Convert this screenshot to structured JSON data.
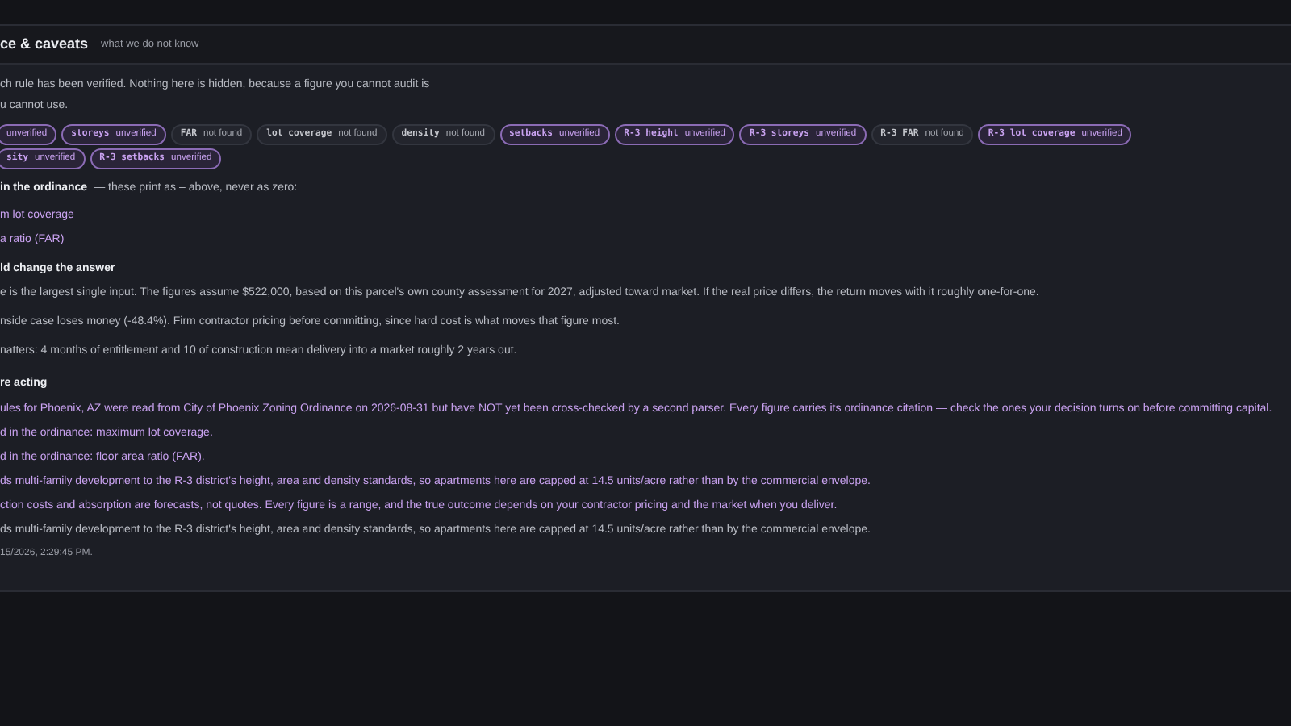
{
  "header": {
    "title": "ce & caveats",
    "subtitle": "what we do not know"
  },
  "intro": [
    "ch rule has been verified. Nothing here is hidden, because a figure you cannot audit is",
    "u cannot use."
  ],
  "badge_rows": [
    [
      {
        "status": "unverified",
        "kind": "unverified"
      },
      {
        "name": "storeys",
        "status": "unverified",
        "kind": "unverified"
      },
      {
        "name": "FAR",
        "status": "not found",
        "kind": "missing"
      },
      {
        "name": "lot coverage",
        "status": "not found",
        "kind": "missing"
      },
      {
        "name": "density",
        "status": "not found",
        "kind": "missing"
      },
      {
        "name": "setbacks",
        "status": "unverified",
        "kind": "unverified"
      },
      {
        "name": "R-3 height",
        "status": "unverified",
        "kind": "unverified"
      },
      {
        "name": "R-3 storeys",
        "status": "unverified",
        "kind": "unverified"
      },
      {
        "name": "R-3 FAR",
        "status": "not found",
        "kind": "missing"
      },
      {
        "name": "R-3 lot coverage",
        "status": "unverified",
        "kind": "unverified"
      }
    ],
    [
      {
        "name": "sity",
        "status": "unverified",
        "kind": "unverified"
      },
      {
        "name": "R-3 setbacks",
        "status": "unverified",
        "kind": "unverified"
      }
    ]
  ],
  "missing": {
    "heading": "in the ordinance",
    "note": "— these print as – above, never as zero:",
    "items": [
      "m lot coverage",
      "a ratio (FAR)"
    ]
  },
  "sensitivity": {
    "heading": "ld change the answer",
    "lines": [
      "e is the largest single input. The figures assume $522,000, based on this parcel's own county assessment for 2027, adjusted toward market. If the real price differs, the return moves with it roughly one-for-one.",
      "nside case loses money (-48.4%). Firm contractor pricing before committing, since hard cost is what moves that figure most.",
      "natters: 4 months of entitlement and 10 of construction mean delivery into a market roughly 2 years out."
    ]
  },
  "before_acting": {
    "heading": "re acting",
    "lines": [
      {
        "text": "ules for Phoenix, AZ were read from City of Phoenix Zoning Ordinance on 2026-08-31 but have NOT yet been cross-checked by a second parser. Every figure carries its ordinance citation — check the ones your decision turns on before committing capital.",
        "kind": "warning"
      },
      {
        "text": "d in the ordinance: maximum lot coverage.",
        "kind": "warning"
      },
      {
        "text": "d in the ordinance: floor area ratio (FAR).",
        "kind": "warning"
      },
      {
        "text": "ds multi-family development to the R-3 district's height, area and density standards, so apartments here are capped at 14.5 units/acre rather than by the commercial envelope.",
        "kind": "warning"
      },
      {
        "text": "ction costs and absorption are forecasts, not quotes. Every figure is a range, and the true outcome depends on your contractor pricing and the market when you deliver.",
        "kind": "warning"
      },
      {
        "text": "ds multi-family development to the R-3 district's height, area and density standards, so apartments here are capped at 14.5 units/acre rather than by the commercial envelope.",
        "kind": "note"
      }
    ]
  },
  "timestamp": "15/2026, 2:29:45 PM."
}
